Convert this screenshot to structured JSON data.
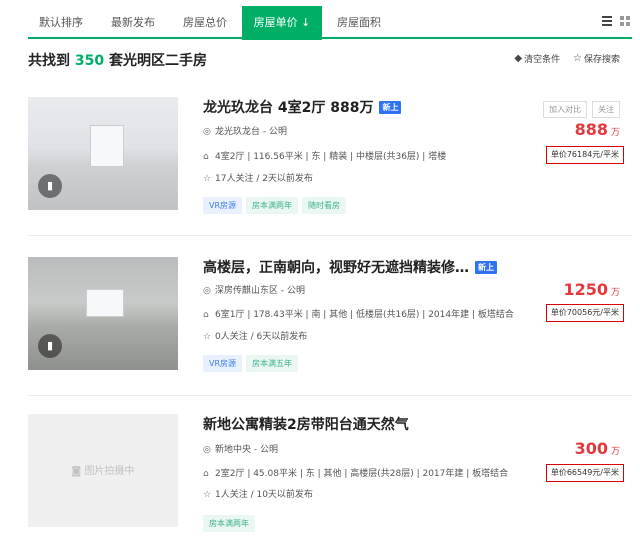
{
  "sort_tabs": [
    {
      "label": "默认排序"
    },
    {
      "label": "最新发布"
    },
    {
      "label": "房屋总价"
    },
    {
      "label": "房屋单价 ↓"
    },
    {
      "label": "房屋面积"
    }
  ],
  "result": {
    "prefix": "共找到",
    "count": "350",
    "suffix": "套光明区二手房"
  },
  "header_actions": {
    "clear": "清空条件",
    "save": "保存搜索"
  },
  "listings": [
    {
      "title": "龙光玖龙台 4室2厅 888万",
      "badge": "新上",
      "community": "龙光玖龙台 - 公明",
      "details": "4室2厅 | 116.56平米 | 东 | 精装 | 中楼层(共36层) | 塔楼",
      "follow": "17人关注 / 2天以前发布",
      "tags": [
        "VR房源",
        "房本满两年",
        "随时看房"
      ],
      "buttons": [
        "加入对比",
        "关注"
      ],
      "price": "888",
      "price_unit": "万",
      "unit_price": "单价76184元/平米"
    },
    {
      "title": "高楼层，正南朝向，视野好无遮挡精装修…",
      "badge": "新上",
      "community": "深房传麒山东区 - 公明",
      "details": "6室1厅 | 178.43平米 | 南 | 其他 | 低楼层(共16层) | 2014年建 | 板塔结合",
      "follow": "0人关注 / 6天以前发布",
      "tags": [
        "VR房源",
        "房本满五年"
      ],
      "price": "1250",
      "price_unit": "万",
      "unit_price": "单价70056元/平米"
    },
    {
      "title": "新地公寓精装2房带阳台通天然气",
      "community": "新地中央 - 公明",
      "details": "2室2厅 | 45.08平米 | 东 | 其他 | 高楼层(共28层) | 2017年建 | 板塔结合",
      "follow": "1人关注 / 10天以前发布",
      "tags": [
        "房本满两年"
      ],
      "price": "300",
      "price_unit": "万",
      "unit_price": "单价66549元/平米",
      "image_placeholder": "图片拍摄中"
    }
  ],
  "colors": {
    "accent_green": "#00ae66",
    "price_red": "#e4393c",
    "highlight_box": "#d90000",
    "new_badge_blue": "#3072f6"
  }
}
